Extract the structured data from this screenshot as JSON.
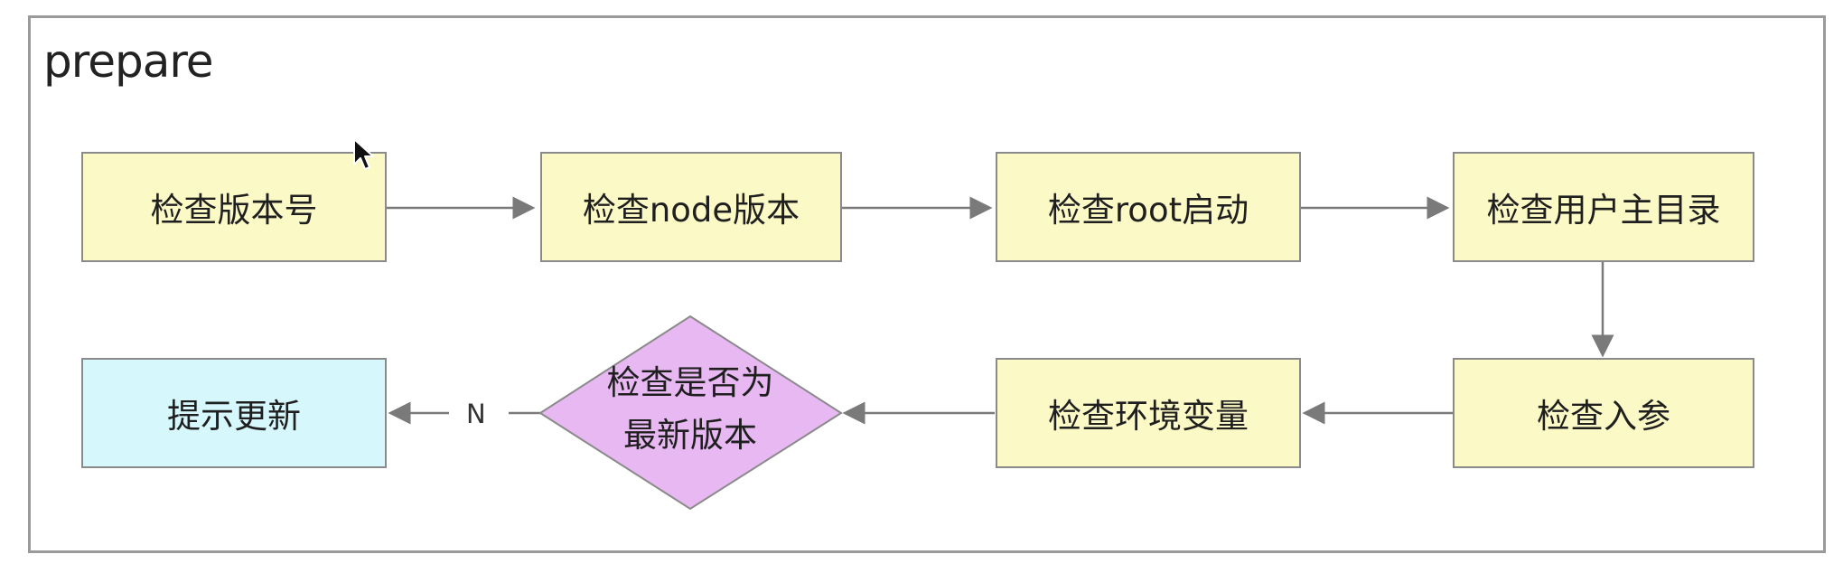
{
  "frame": {
    "title": "prepare"
  },
  "nodes": {
    "check_version": "检查版本号",
    "check_node_version": "检查node版本",
    "check_root_start": "检查root启动",
    "check_user_home": "检查用户主目录",
    "check_args": "检查入参",
    "check_env": "检查环境变量",
    "check_latest_line1": "检查是否为",
    "check_latest_line2": "最新版本",
    "prompt_update": "提示更新"
  },
  "edges": {
    "no_label": "N"
  },
  "colors": {
    "process_fill": "#fbf9c6",
    "decision_fill": "#e8b8f2",
    "terminal_fill": "#d6f7fc",
    "border": "#8a8a8a",
    "arrow": "#7a7a7a"
  },
  "icons": {
    "cursor": "mouse-pointer-icon"
  }
}
